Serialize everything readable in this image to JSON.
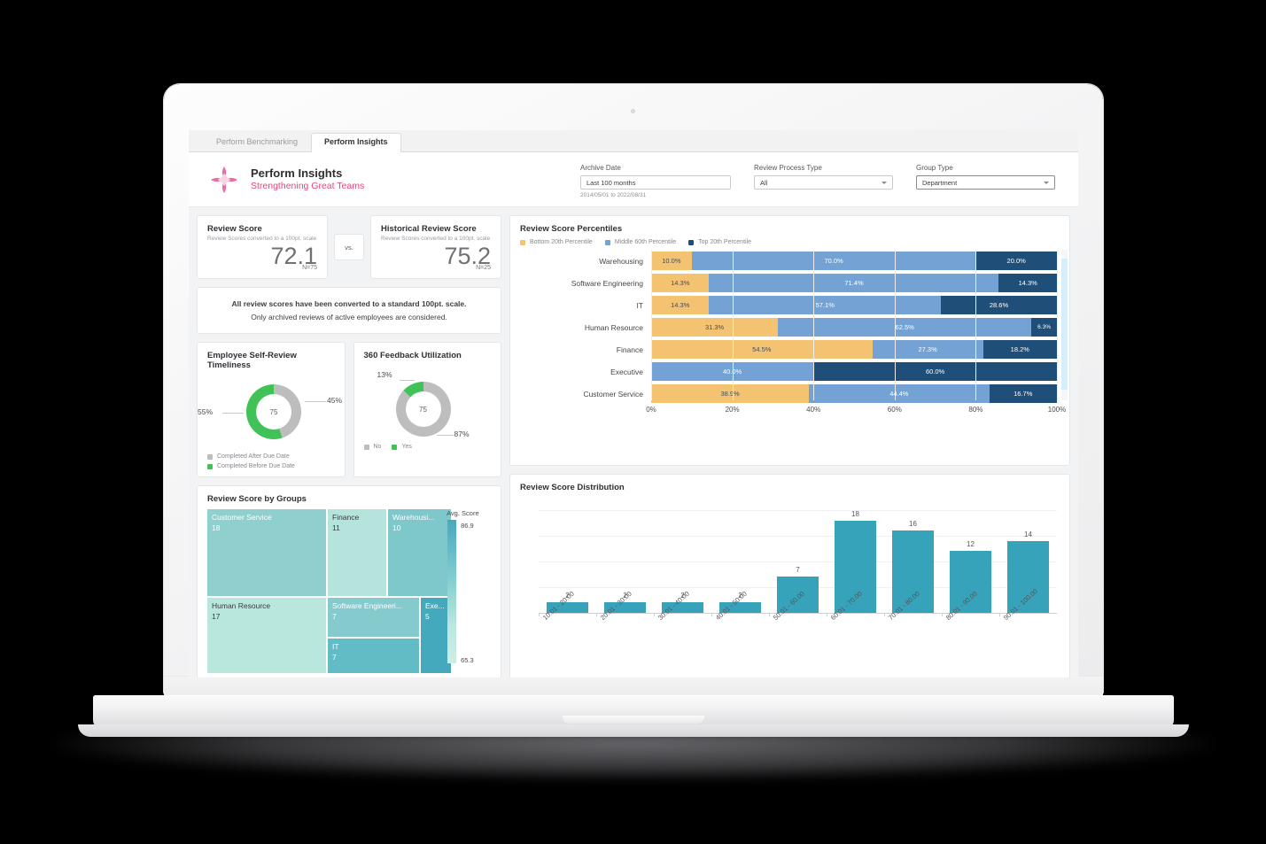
{
  "window": {
    "tabs": [
      {
        "label": "Perform Benchmarking",
        "active": false
      },
      {
        "label": "Perform Insights",
        "active": true
      }
    ]
  },
  "header": {
    "logo_icon": "four-petal-flower-logo",
    "title": "Perform Insights",
    "tagline": "Strengthening Great Teams",
    "accent_color": "#e8437f"
  },
  "filters": {
    "archive_date": {
      "label": "Archive Date",
      "value": "Last 100 months",
      "range": "2014/05/01 to 2022/08/31"
    },
    "review_process_type": {
      "label": "Review Process Type",
      "value": "All",
      "caret_icon": "chevron-down-icon"
    },
    "group_type": {
      "label": "Group Type",
      "value": "Department",
      "caret_icon": "chevron-down-icon"
    }
  },
  "kpis": {
    "current": {
      "title": "Review Score",
      "subtitle": "Review Scores converted to a 100pt. scale",
      "value": "72.1",
      "n": "N=75"
    },
    "vs_label": "vs.",
    "historical": {
      "title": "Historical Review Score",
      "subtitle": "Review Scores converted to a 100pt. scale",
      "value": "75.2",
      "n": "N=25"
    }
  },
  "note": {
    "line1": "All review scores have been converted to a standard 100pt. scale.",
    "line2": "Only archived reviews of active employees are considered."
  },
  "timeliness": {
    "title": "Employee Self-Review Timeliness",
    "center": "75",
    "left_pct": "55%",
    "right_pct": "45%",
    "legend": [
      {
        "label": "Completed After Due Date",
        "color": "#bdbdbd"
      },
      {
        "label": "Completed Before Due Date",
        "color": "#41c257"
      }
    ],
    "chart_data": {
      "type": "pie",
      "title": "Employee Self-Review Timeliness",
      "categories": [
        "Completed Before Due Date",
        "Completed After Due Date"
      ],
      "values": [
        55,
        45
      ],
      "center_value": 75
    }
  },
  "feedback360": {
    "title": "360 Feedback Utilization",
    "center": "75",
    "top_pct": "13%",
    "bottom_pct": "87%",
    "legend": [
      {
        "label": "No",
        "color": "#bdbdbd"
      },
      {
        "label": "Yes",
        "color": "#41c257"
      }
    ],
    "chart_data": {
      "type": "pie",
      "title": "360 Feedback Utilization",
      "categories": [
        "Yes",
        "No"
      ],
      "values": [
        13,
        87
      ],
      "center_value": 75
    }
  },
  "percentiles": {
    "title": "Review Score Percentiles",
    "legend": [
      {
        "label": "Bottom 20th Percentile",
        "color": "#f3c372"
      },
      {
        "label": "Middle 60th Percentile",
        "color": "#74a2d4"
      },
      {
        "label": "Top 20th Percentile",
        "color": "#1f4e79"
      }
    ],
    "axis_ticks": [
      "0%",
      "20%",
      "40%",
      "60%",
      "80%",
      "100%"
    ],
    "chart_data": {
      "type": "bar",
      "title": "Review Score Percentiles",
      "orientation": "horizontal",
      "stacked": true,
      "categories": [
        "Warehousing",
        "Software Engineering",
        "IT",
        "Human Resource",
        "Finance",
        "Executive",
        "Customer Service"
      ],
      "series": [
        {
          "name": "Bottom 20th Percentile",
          "color": "#f3c372",
          "values": [
            10.0,
            14.3,
            14.3,
            31.3,
            54.5,
            0.0,
            38.9
          ]
        },
        {
          "name": "Middle 60th Percentile",
          "color": "#74a2d4",
          "values": [
            70.0,
            71.4,
            57.1,
            62.5,
            27.3,
            40.0,
            44.4
          ]
        },
        {
          "name": "Top 20th Percentile",
          "color": "#1f4e79",
          "values": [
            20.0,
            14.3,
            28.6,
            6.3,
            18.2,
            60.0,
            16.7
          ]
        }
      ],
      "labels": [
        [
          "10.0%",
          "70.0%",
          "20.0%"
        ],
        [
          "14.3%",
          "71.4%",
          "14.3%"
        ],
        [
          "14.3%",
          "57.1%",
          "28.6%"
        ],
        [
          "31.3%",
          "62.5%",
          "6.3%"
        ],
        [
          "54.5%",
          "27.3%",
          "18.2%"
        ],
        [
          "",
          "40.0%",
          "60.0%"
        ],
        [
          "38.9%",
          "44.4%",
          "16.7%"
        ]
      ],
      "xlabel": "",
      "ylabel": "",
      "xlim": [
        0,
        100
      ],
      "grid": true,
      "legend_position": "top"
    }
  },
  "treemap": {
    "title": "Review Score by Groups",
    "scale_title": "Avg. Score",
    "scale_max": "86.9",
    "scale_min": "65.3",
    "chart_data": {
      "type": "treemap",
      "title": "Review Score by Groups",
      "color_legend": {
        "label": "Avg. Score",
        "max": 86.9,
        "min": 65.3
      },
      "items": [
        {
          "label": "Customer Service",
          "display_label": "Customer Service",
          "value": 18,
          "color": "#8fd0cf",
          "text_color": "#ffffff"
        },
        {
          "label": "Finance",
          "display_label": "Finance",
          "value": 11,
          "color": "#b5e4dc",
          "text_color": "#3a3b3f"
        },
        {
          "label": "Warehousing",
          "display_label": "Warehousi...",
          "value": 10,
          "color": "#7ec7cb",
          "text_color": "#ffffff"
        },
        {
          "label": "Human Resource",
          "display_label": "Human Resource",
          "value": 17,
          "color": "#b9e6dd",
          "text_color": "#3a3b3f"
        },
        {
          "label": "Software Engineering",
          "display_label": "Software Engineeri...",
          "value": 7,
          "color": "#85cbcd",
          "text_color": "#ffffff"
        },
        {
          "label": "IT",
          "display_label": "IT",
          "value": 7,
          "color": "#62bcc6",
          "text_color": "#ffffff"
        },
        {
          "label": "Executive",
          "display_label": "Exe...",
          "value": 5,
          "color": "#45a9bd",
          "text_color": "#ffffff"
        }
      ]
    }
  },
  "distribution": {
    "title": "Review Score Distribution",
    "chart_data": {
      "type": "bar",
      "title": "Review Score Distribution",
      "categories": [
        "10.01 - 20.00",
        "20.01 - 30.00",
        "30.01 - 40.00",
        "40.01 - 50.00",
        "50.01 - 60.00",
        "60.01 - 70.00",
        "70.01 - 80.00",
        "80.01 - 90.00",
        "90.01 - 100.00"
      ],
      "values": [
        2,
        2,
        2,
        2,
        7,
        18,
        16,
        12,
        14
      ],
      "bar_color": "#36a3bb",
      "xlabel": "",
      "ylabel": "",
      "ylim": [
        0,
        20
      ],
      "grid": true
    }
  }
}
